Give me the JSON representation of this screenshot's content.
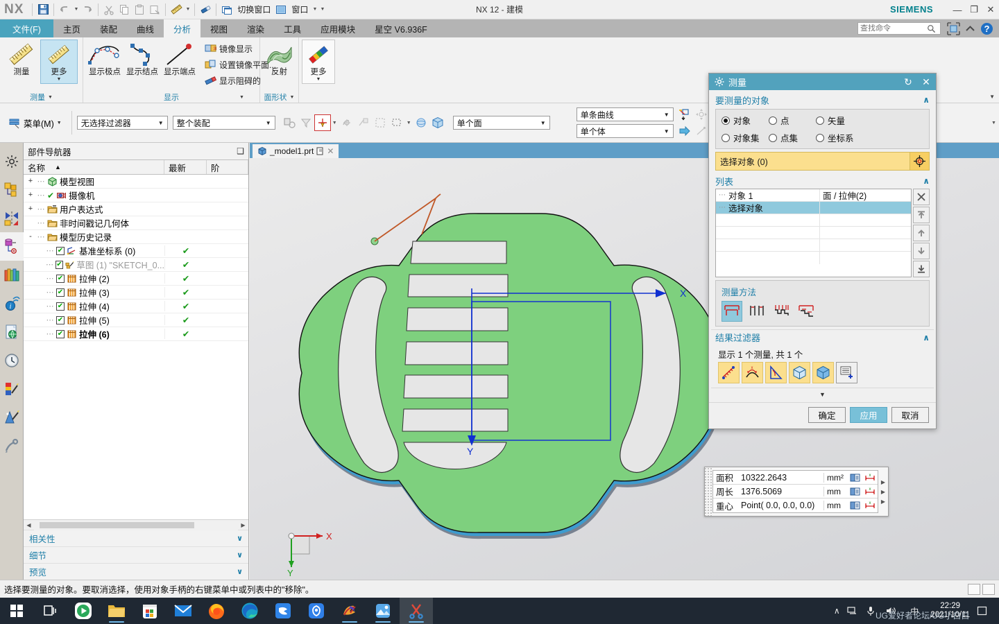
{
  "window": {
    "app_name": "NX",
    "title": "NX 12 - 建模",
    "brand": "SIEMENS",
    "minimize": "—",
    "restore": "❐",
    "close": "✕"
  },
  "quick_access": {
    "save": "保存",
    "undo": "撤销",
    "redo": "重做",
    "cut": "剪切",
    "copy": "复制",
    "paste": "粘贴",
    "paste_special": "粘贴特殊",
    "measure": "测量",
    "erase": "擦除",
    "switch_window_label": "切换窗口",
    "window_label": "窗口"
  },
  "ribbon": {
    "tabs": [
      {
        "label": "文件(F)",
        "type": "file"
      },
      {
        "label": "主页",
        "type": "normal"
      },
      {
        "label": "装配",
        "type": "normal"
      },
      {
        "label": "曲线",
        "type": "normal"
      },
      {
        "label": "分析",
        "type": "active"
      },
      {
        "label": "视图",
        "type": "normal"
      },
      {
        "label": "渲染",
        "type": "normal"
      },
      {
        "label": "工具",
        "type": "normal"
      },
      {
        "label": "应用模块",
        "type": "normal"
      },
      {
        "label": "星空 V6.936F",
        "type": "normal"
      }
    ],
    "search_placeholder": "查找命令",
    "groups": [
      {
        "title": "测量",
        "buttons": [
          {
            "label": "测量",
            "icon": "ruler-icon",
            "selected": false,
            "has_arrow": false
          },
          {
            "label": "更多",
            "icon": "measure-more-icon",
            "selected": true,
            "has_arrow": true
          }
        ]
      },
      {
        "title": "显示",
        "buttons": [
          {
            "label": "显示极点",
            "icon": "show-poles-icon"
          },
          {
            "label": "显示结点",
            "icon": "show-knots-icon"
          },
          {
            "label": "显示端点",
            "icon": "show-endpoints-icon"
          }
        ],
        "small_items": [
          {
            "label": "镜像显示",
            "icon": "mirror-display-icon"
          },
          {
            "label": "设置镜像平面...",
            "icon": "set-mirror-plane-icon"
          },
          {
            "label": "显示阻碍的",
            "icon": "show-obstructed-icon"
          }
        ]
      },
      {
        "title": "面形状",
        "buttons": [
          {
            "label": "反射",
            "icon": "reflection-icon"
          }
        ]
      },
      {
        "title": "",
        "buttons": [
          {
            "label": "更多",
            "icon": "face-more-icon",
            "has_arrow": true
          }
        ]
      }
    ]
  },
  "selection_bar": {
    "menu_label": "菜单(M)",
    "filter_value": "无选择过滤器",
    "scope_value": "整个装配",
    "face_rule_value": "单个面",
    "curve_rule_value": "单条曲线",
    "body_rule_value": "单个体"
  },
  "rail": {
    "items": [
      {
        "name": "settings-icon",
        "label": "设置",
        "active": false
      },
      {
        "name": "assembly-navigator-icon",
        "label": "装配导航器",
        "active": false
      },
      {
        "name": "constraint-navigator-icon",
        "label": "约束导航器",
        "active": false
      },
      {
        "name": "part-navigator-icon",
        "label": "部件导航器",
        "active": true
      },
      {
        "name": "reuse-library-icon",
        "label": "重用库",
        "active": false
      },
      {
        "name": "hd3d-tools-icon",
        "label": "HD3D 工具",
        "active": false
      },
      {
        "name": "web-browser-icon",
        "label": "Web 浏览器",
        "active": false
      },
      {
        "name": "history-icon",
        "label": "历史记录",
        "active": false
      },
      {
        "name": "system-materials-icon",
        "label": "系统材料",
        "active": false
      },
      {
        "name": "system-scenes-icon",
        "label": "系统场景",
        "active": false
      },
      {
        "name": "process-studio-icon",
        "label": "加工向导",
        "active": false
      }
    ]
  },
  "navigator": {
    "title": "部件导航器",
    "columns": [
      "名称",
      "最新",
      "阶"
    ],
    "rows": [
      {
        "expander": "+",
        "check": "",
        "label": "模型视图",
        "icon": "model-view-icon",
        "status": "",
        "gray": false,
        "bold": false,
        "indent": 0
      },
      {
        "expander": "+",
        "check": "",
        "label": "摄像机",
        "icon": "camera-icon",
        "status": "",
        "gray": false,
        "bold": false,
        "indent": 0,
        "prefix_check": true
      },
      {
        "expander": "+",
        "check": "",
        "label": "用户表达式",
        "icon": "folder-icon",
        "status": "",
        "gray": false,
        "bold": false,
        "indent": 0
      },
      {
        "expander": "",
        "check": "",
        "label": "非时间戳记几何体",
        "icon": "folder-icon",
        "status": "",
        "gray": false,
        "bold": false,
        "indent": 0
      },
      {
        "expander": "-",
        "check": "",
        "label": "模型历史记录",
        "icon": "folder-icon",
        "status": "",
        "gray": false,
        "bold": false,
        "indent": 0
      },
      {
        "expander": "",
        "check": "✔",
        "label": "基准坐标系 (0)",
        "icon": "datum-csys-icon",
        "status": "✔",
        "gray": false,
        "bold": false,
        "indent": 1
      },
      {
        "expander": "",
        "check": "✔",
        "label": "草图 (1) \"SKETCH_0...",
        "icon": "sketch-icon",
        "status": "✔",
        "gray": true,
        "bold": false,
        "indent": 1
      },
      {
        "expander": "",
        "check": "✔",
        "label": "拉伸 (2)",
        "icon": "extrude-icon",
        "status": "✔",
        "gray": false,
        "bold": false,
        "indent": 1
      },
      {
        "expander": "",
        "check": "✔",
        "label": "拉伸 (3)",
        "icon": "extrude-icon",
        "status": "✔",
        "gray": false,
        "bold": false,
        "indent": 1
      },
      {
        "expander": "",
        "check": "✔",
        "label": "拉伸 (4)",
        "icon": "extrude-icon",
        "status": "✔",
        "gray": false,
        "bold": false,
        "indent": 1
      },
      {
        "expander": "",
        "check": "✔",
        "label": "拉伸 (5)",
        "icon": "extrude-icon",
        "status": "✔",
        "gray": false,
        "bold": false,
        "indent": 1
      },
      {
        "expander": "",
        "check": "✔",
        "label": "拉伸 (6)",
        "icon": "extrude-icon",
        "status": "✔",
        "gray": false,
        "bold": true,
        "indent": 1
      }
    ],
    "panels": [
      {
        "label": "相关性"
      },
      {
        "label": "细节"
      },
      {
        "label": "预览"
      }
    ]
  },
  "graphics": {
    "tab_label": "_model1.prt",
    "tab_modified_icon": "modified-icon",
    "tab_close": "✕",
    "axis_x": "X",
    "axis_y": "Y",
    "triad_x": "X",
    "triad_y": "Y"
  },
  "measure_popup": {
    "rows": [
      {
        "key": "面积",
        "value": "10322.2643",
        "unit": "mm²"
      },
      {
        "key": "周长",
        "value": "1376.5069",
        "unit": "mm"
      },
      {
        "key": "重心",
        "value": "Point( 0.0, 0.0, 0.0)",
        "unit": "mm"
      }
    ]
  },
  "dialog": {
    "title": "测量",
    "reset_icon": "reset-icon",
    "close_icon": "close-icon",
    "section_object": "要测量的对象",
    "radios": [
      {
        "label": "对象",
        "selected": true
      },
      {
        "label": "点",
        "selected": false
      },
      {
        "label": "矢量",
        "selected": false
      },
      {
        "label": "对象集",
        "selected": false
      },
      {
        "label": "点集",
        "selected": false
      },
      {
        "label": "坐标系",
        "selected": false
      }
    ],
    "select_object_label": "选择对象 (0)",
    "select_object_icon": "select-target-icon",
    "section_list": "列表",
    "list_rows": [
      {
        "c1": "对象 1",
        "c2": "面 / 拉伸(2)",
        "selected": false
      },
      {
        "c1": "选择对象",
        "c2": "",
        "selected": true
      },
      {
        "c1": "",
        "c2": "",
        "selected": false
      },
      {
        "c1": "",
        "c2": "",
        "selected": false
      },
      {
        "c1": "",
        "c2": "",
        "selected": false
      },
      {
        "c1": "",
        "c2": "",
        "selected": false
      }
    ],
    "list_buttons": [
      {
        "name": "remove-button",
        "glyph": "✕"
      },
      {
        "name": "move-to-top-button",
        "glyph": "⤒"
      },
      {
        "name": "move-up-button",
        "glyph": "↑"
      },
      {
        "name": "move-down-button",
        "glyph": "↓"
      },
      {
        "name": "move-to-bottom-button",
        "glyph": "⤓"
      }
    ],
    "section_method": "测量方法",
    "methods": [
      {
        "name": "method-simple",
        "selected": true
      },
      {
        "name": "method-two-gaps",
        "selected": false
      },
      {
        "name": "method-multi-step",
        "selected": false
      },
      {
        "name": "method-stair",
        "selected": false
      }
    ],
    "section_filter": "结果过滤器",
    "filter_text": "显示 1 个测量, 共 1 个",
    "filter_buttons": [
      {
        "name": "filter-point-icon",
        "active": true
      },
      {
        "name": "filter-curve-icon",
        "active": true
      },
      {
        "name": "filter-angle-icon",
        "active": true
      },
      {
        "name": "filter-face-icon",
        "active": true
      },
      {
        "name": "filter-body-icon",
        "active": true
      },
      {
        "name": "filter-add-list-icon",
        "active": false
      }
    ],
    "more_arrow": "▼",
    "buttons": {
      "ok": "确定",
      "apply": "应用",
      "cancel": "取消"
    }
  },
  "status_bar": {
    "message": "选择要测量的对象。要取消选择，使用对象手柄的右键菜单中或列表中的\"移除\"。"
  },
  "taskbar": {
    "items": [
      {
        "name": "start-button",
        "icon": "windows-icon",
        "running": false
      },
      {
        "name": "task-view-button",
        "icon": "task-view-icon",
        "running": false
      },
      {
        "name": "media-player",
        "icon": "player-icon",
        "running": false
      },
      {
        "name": "file-explorer",
        "icon": "folder-icon",
        "running": true
      },
      {
        "name": "microsoft-store",
        "icon": "store-icon",
        "running": false
      },
      {
        "name": "mail",
        "icon": "mail-icon",
        "running": false
      },
      {
        "name": "firefox",
        "icon": "firefox-icon",
        "running": true
      },
      {
        "name": "edge",
        "icon": "edge-icon",
        "running": false
      },
      {
        "name": "foxmail",
        "icon": "bird-icon",
        "running": false
      },
      {
        "name": "security-app",
        "icon": "shield-icon",
        "running": false
      },
      {
        "name": "3d-app",
        "icon": "ribbon-icon",
        "running": true
      },
      {
        "name": "photos",
        "icon": "photos-icon",
        "running": true
      },
      {
        "name": "snipping-tool",
        "icon": "scissors-icon",
        "running": true
      }
    ],
    "tray": [
      {
        "name": "show-hidden-icons",
        "glyph": "∧"
      },
      {
        "name": "network-icon",
        "glyph": "🖳"
      },
      {
        "name": "microphone-icon",
        "glyph": "🎤"
      },
      {
        "name": "volume-icon",
        "glyph": "🔊"
      },
      {
        "name": "ime-indicator",
        "glyph": "中"
      }
    ],
    "clock_time": "22:29",
    "clock_date": "2021/10/11",
    "watermark": "UG爱好者论坛/UG小白白",
    "action_center": "▭"
  }
}
